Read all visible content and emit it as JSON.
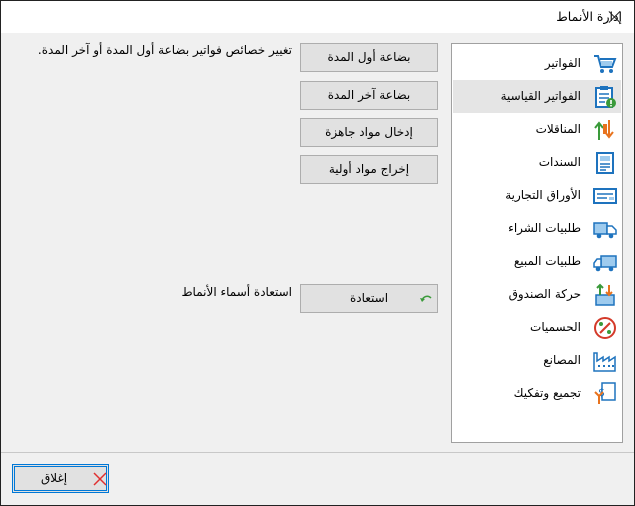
{
  "window": {
    "title": "إدارة الأنماط"
  },
  "sidebar": {
    "items": [
      {
        "label": "الفواتير",
        "icon": "cart-icon"
      },
      {
        "label": "الفواتير القياسية",
        "icon": "clipboard-icon",
        "selected": true
      },
      {
        "label": "المناقلات",
        "icon": "transfer-icon"
      },
      {
        "label": "السندات",
        "icon": "voucher-icon"
      },
      {
        "label": "الأوراق التجارية",
        "icon": "cheque-icon"
      },
      {
        "label": "طلبيات الشراء",
        "icon": "purchase-truck-icon"
      },
      {
        "label": "طلبيات المبيع",
        "icon": "sales-truck-icon"
      },
      {
        "label": "حركة الصندوق",
        "icon": "cashbox-icon"
      },
      {
        "label": "الحسميات",
        "icon": "discount-icon"
      },
      {
        "label": "المصانع",
        "icon": "factory-icon"
      },
      {
        "label": "تجميع وتفكيك",
        "icon": "assembly-icon"
      }
    ]
  },
  "main": {
    "description": "تغيير خصائص فواتير بضاعة أول المدة أو آخر المدة.",
    "buttons": {
      "opening_goods": "بضاعة أول المدة",
      "closing_goods": "بضاعة آخر المدة",
      "enter_ready_materials": "إدخال مواد جاهزة",
      "output_raw_materials": "إخراج مواد أولية"
    },
    "restore_label": "استعادة أسماء الأنماط",
    "restore_button": "استعادة"
  },
  "footer": {
    "close_button": "إغلاق"
  },
  "colors": {
    "accent": "#0078d7",
    "icon_blue": "#1e73be",
    "icon_orange": "#e8731e",
    "icon_green": "#3a9a3a",
    "close_red": "#e03030"
  }
}
